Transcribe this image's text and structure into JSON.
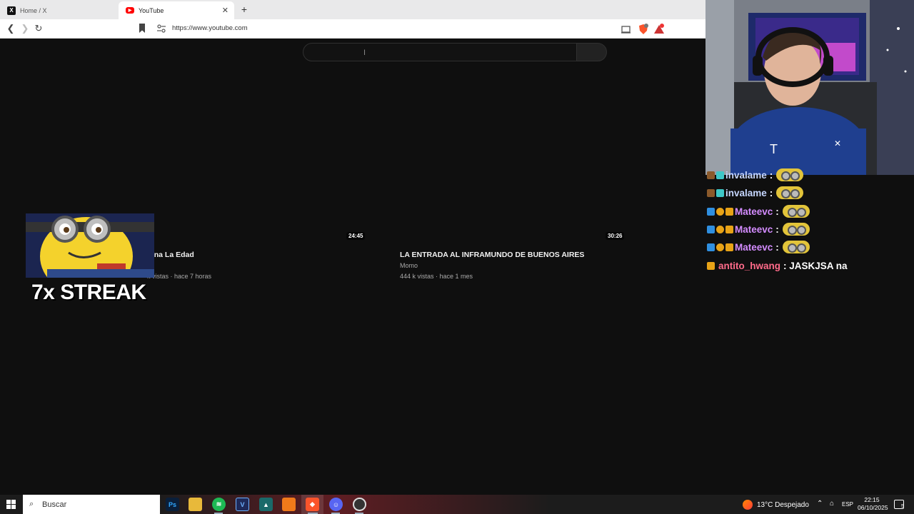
{
  "browser": {
    "tabs": [
      {
        "title": "Home / X",
        "active": false,
        "icon": "x-logo-icon"
      },
      {
        "title": "YouTube",
        "active": true,
        "icon": "youtube-icon"
      }
    ],
    "url": "https://www.youtube.com"
  },
  "youtube": {
    "videos": [
      {
        "title": "vina La Edad",
        "duration": "24:45",
        "meta": "k vistas · hace 7 horas"
      },
      {
        "title": "LA ENTRADA AL INFRAMUNDO DE BUENOS AIRES",
        "duration": "30:26",
        "channel": "Momo",
        "meta": "444 k vistas · hace 1 mes"
      }
    ]
  },
  "overlay": {
    "streak_text": "7x STREAK"
  },
  "chat": {
    "messages": [
      {
        "user": "invalame",
        "color": "#c6d7ff",
        "text": ":"
      },
      {
        "user": "invalame",
        "color": "#c6d7ff",
        "text": ":"
      },
      {
        "user": "Mateevc",
        "color": "#d48cff",
        "text": ":"
      },
      {
        "user": "Mateevc",
        "color": "#d48cff",
        "text": ":"
      },
      {
        "user": "Mateevc",
        "color": "#d48cff",
        "text": ":"
      },
      {
        "user": "antito_hwang",
        "color": "#ff6b8a",
        "text": ": JASKJSA na"
      }
    ]
  },
  "taskbar": {
    "search_label": "Buscar",
    "apps": [
      "photoshop-icon",
      "file-explorer-icon",
      "spotify-icon",
      "vegas-icon",
      "app-icon",
      "fl-studio-icon",
      "brave-icon",
      "discord-icon",
      "obs-icon"
    ],
    "weather": "13°C  Despejado",
    "language": "ESP",
    "time": "22:15",
    "date": "06/10/2025",
    "notifications": "5"
  },
  "colors": {
    "youtube_bg": "#0f0f0f",
    "accent_red": "#ff0000",
    "taskbar": "#1c1c1c"
  }
}
